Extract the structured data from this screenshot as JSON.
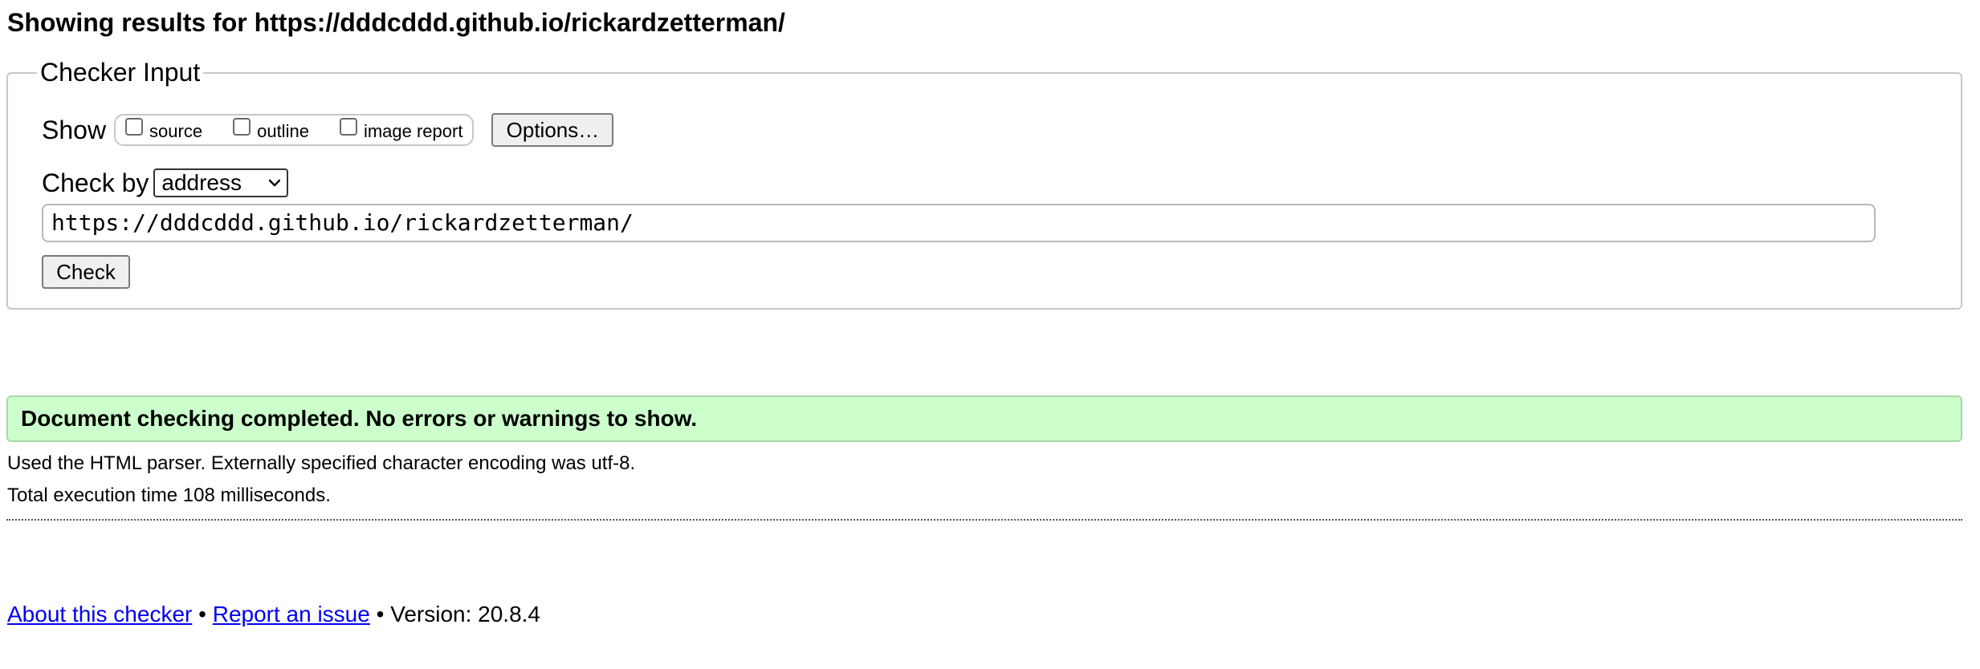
{
  "page": {
    "heading": "Showing results for https://dddcddd.github.io/rickardzetterman/"
  },
  "checker_input": {
    "legend": "Checker Input",
    "show_label": "Show",
    "options": [
      {
        "label": "source",
        "checked": false
      },
      {
        "label": "outline",
        "checked": false
      },
      {
        "label": "image report",
        "checked": false
      }
    ],
    "options_button": "Options…",
    "check_by_label": "Check by",
    "check_by_value": "address",
    "url_value": "https://dddcddd.github.io/rickardzetterman/",
    "check_button": "Check"
  },
  "results": {
    "success_message": "Document checking completed. No errors or warnings to show.",
    "parser_info": "Used the HTML parser. Externally specified character encoding was utf-8.",
    "execution_time": "Total execution time 108 milliseconds."
  },
  "footer": {
    "about_link": "About this checker",
    "separator": "•",
    "report_link": "Report an issue",
    "version_text": "Version: 20.8.4"
  },
  "colors": {
    "success_background": "#ccffcc",
    "link": "#0000ee",
    "border": "#c7c7c7"
  },
  "icons": {
    "select_arrow": "chevron-down-icon"
  }
}
